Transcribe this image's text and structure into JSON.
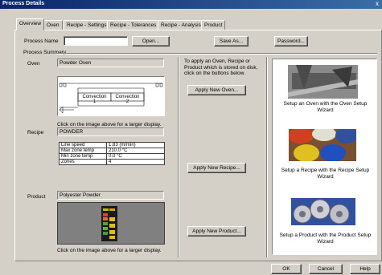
{
  "window": {
    "title": "Process Details",
    "close": "x"
  },
  "tabs": [
    {
      "label": "Overview",
      "active": true
    },
    {
      "label": "Oven"
    },
    {
      "label": "Recipe - Settings"
    },
    {
      "label": "Recipe - Tolerances"
    },
    {
      "label": "Recipe - Analysis"
    },
    {
      "label": "Product"
    }
  ],
  "process": {
    "name_label": "Process Name",
    "name_value": "",
    "open_button": "Open...",
    "save_as_button": "Save As...",
    "password_button": "Password...",
    "summary_label": "Process Summary"
  },
  "oven": {
    "label": "Oven",
    "value": "Powder Oven",
    "zones": [
      "Convection 1",
      "Convection 2"
    ],
    "hint": "Click on the image above for a larger display."
  },
  "recipe": {
    "label": "Recipe",
    "value": "POWDER",
    "rows": [
      {
        "name": "Line speed",
        "value": "1.83 (m/min)"
      },
      {
        "name": "Max zone temp",
        "value": "210.0 °C"
      },
      {
        "name": "Min zone temp",
        "value": "0.0 °C"
      },
      {
        "name": "Zones",
        "value": "4"
      }
    ]
  },
  "product": {
    "label": "Product",
    "value": "Polyester Powder",
    "hint": "Click on the image above for a larger display."
  },
  "apply": {
    "instructions": "To apply an Oven, Recipe or Product which is stored on disk, click on the buttons below.",
    "oven_button": "Apply New Oven...",
    "recipe_button": "Apply New Recipe...",
    "product_button": "Apply New Product..."
  },
  "wizards": {
    "oven": "Setup an Oven with the Oven Setup Wizard",
    "recipe": "Setup a Recipe with the Recipe Setup Wizard",
    "product": "Setup a Product with the Product Setup Wizard"
  },
  "footer": {
    "ok": "OK",
    "cancel": "Cancel",
    "help": "Help"
  }
}
